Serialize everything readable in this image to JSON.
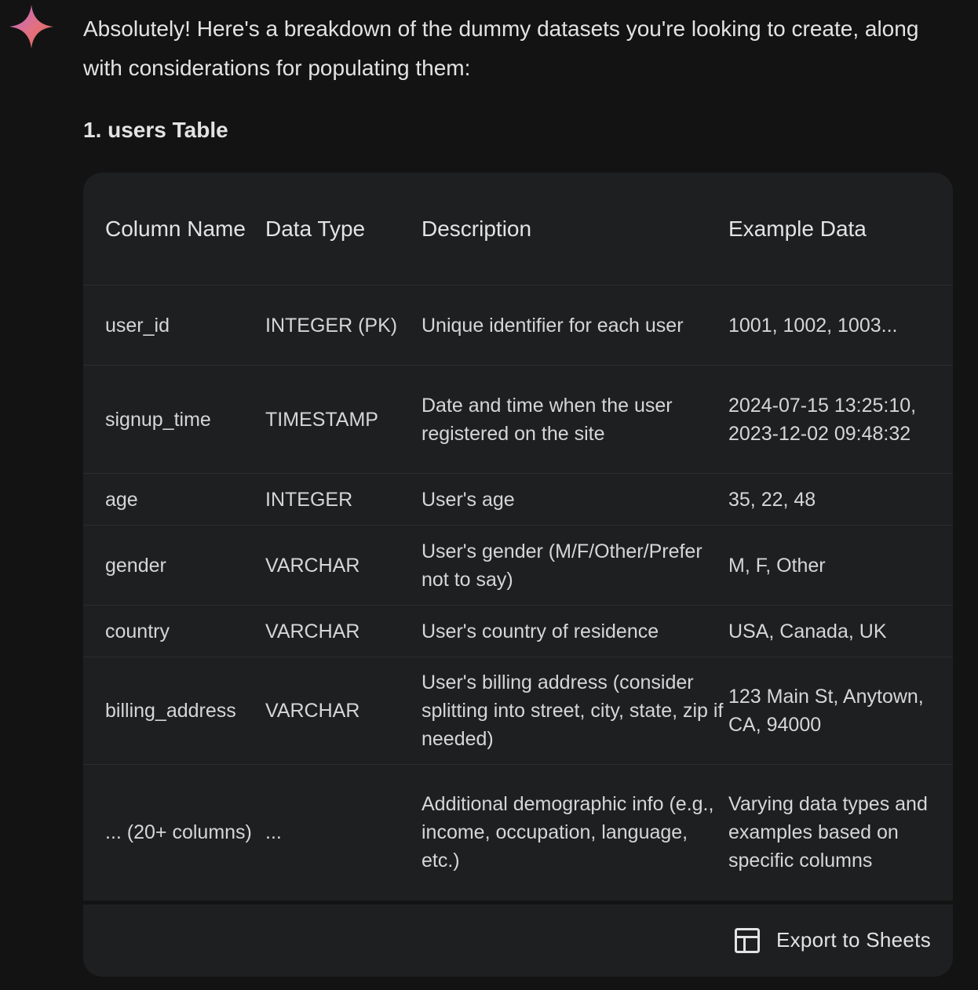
{
  "message": {
    "intro": "Absolutely! Here's a breakdown of the dummy datasets you're looking to create, along with considerations for populating them:",
    "section_heading": "1. users Table"
  },
  "table": {
    "headers": [
      "Column Name",
      "Data Type",
      "Description",
      "Example Data"
    ],
    "rows": [
      [
        "user_id",
        "INTEGER (PK)",
        "Unique identifier for each user",
        "1001, 1002, 1003..."
      ],
      [
        "signup_time",
        "TIMESTAMP",
        "Date and time when the user registered on the site",
        "2024-07-15 13:25:10, 2023-12-02 09:48:32"
      ],
      [
        "age",
        "INTEGER",
        "User's age",
        "35, 22, 48"
      ],
      [
        "gender",
        "VARCHAR",
        "User's gender (M/F/Other/Prefer not to say)",
        "M, F, Other"
      ],
      [
        "country",
        "VARCHAR",
        "User's country of residence",
        "USA, Canada, UK"
      ],
      [
        "billing_address",
        "VARCHAR",
        "User's billing address (consider splitting into street, city, state, zip if needed)",
        "123 Main St, Anytown, CA, 94000"
      ],
      [
        "... (20+ columns)",
        "...",
        "Additional demographic info (e.g., income, occupation, language, etc.)",
        "Varying data types and examples based on specific columns"
      ]
    ]
  },
  "footer": {
    "export_label": "Export to Sheets",
    "export_icon": "table-icon"
  },
  "colors": {
    "background": "#131314",
    "card": "#1e1f20",
    "divider": "#2c2d2f",
    "text": "#e3e3e3"
  }
}
